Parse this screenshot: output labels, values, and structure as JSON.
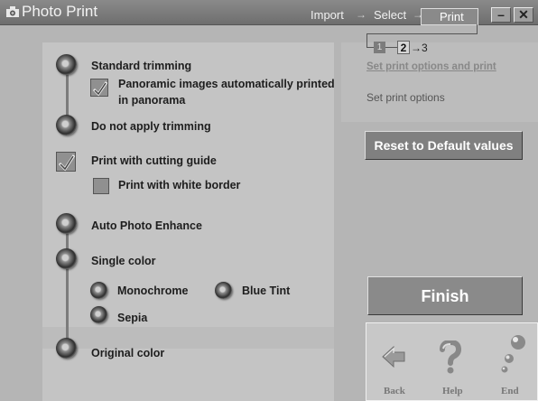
{
  "window": {
    "title": "Photo Print",
    "minimize_glyph": "–",
    "close_glyph": "✕"
  },
  "wizard_steps": {
    "import_label": "Import",
    "select_label": "Select",
    "print_label": "Print",
    "arrow": "→"
  },
  "breadcrumb": {
    "step1": "1",
    "step2": "2",
    "step3": "→3"
  },
  "right_panel": {
    "link_text": "Set print options and print",
    "hint_text": "Set print options",
    "reset_button": "Reset to Default values",
    "finish_button": "Finish"
  },
  "options": {
    "standard_trimming": "Standard trimming",
    "panoramic_line1": "Panoramic images automatically printed",
    "panoramic_line2": "in panorama",
    "no_trimming": "Do not apply trimming",
    "cutting_guide": "Print with cutting guide",
    "white_border": "Print with white border",
    "auto_enhance": "Auto Photo Enhance",
    "single_color": "Single color",
    "monochrome": "Monochrome",
    "blue_tint": "Blue Tint",
    "sepia": "Sepia",
    "original_color": "Original color"
  },
  "nav": {
    "back": "Back",
    "help": "Help",
    "end": "End"
  }
}
